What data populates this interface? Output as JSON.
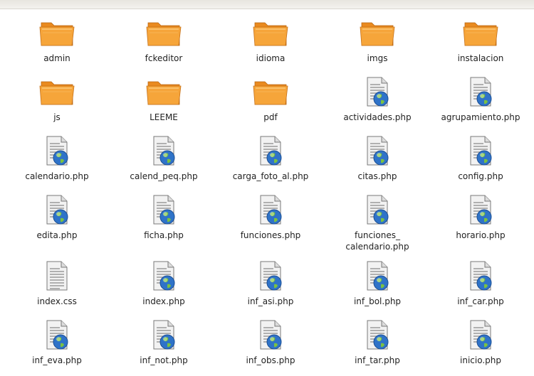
{
  "files": [
    {
      "name": "admin",
      "type": "folder"
    },
    {
      "name": "fckeditor",
      "type": "folder"
    },
    {
      "name": "idioma",
      "type": "folder"
    },
    {
      "name": "imgs",
      "type": "folder"
    },
    {
      "name": "instalacion",
      "type": "folder"
    },
    {
      "name": "js",
      "type": "folder"
    },
    {
      "name": "LEEME",
      "type": "folder"
    },
    {
      "name": "pdf",
      "type": "folder"
    },
    {
      "name": "actividades.php",
      "type": "php"
    },
    {
      "name": "agrupamiento.php",
      "type": "php"
    },
    {
      "name": "calendario.php",
      "type": "php"
    },
    {
      "name": "calend_peq.php",
      "type": "php"
    },
    {
      "name": "carga_foto_al.php",
      "type": "php"
    },
    {
      "name": "citas.php",
      "type": "php"
    },
    {
      "name": "config.php",
      "type": "php"
    },
    {
      "name": "edita.php",
      "type": "php"
    },
    {
      "name": "ficha.php",
      "type": "php"
    },
    {
      "name": "funciones.php",
      "type": "php"
    },
    {
      "name": "funciones_\ncalendario.php",
      "type": "php"
    },
    {
      "name": "horario.php",
      "type": "php"
    },
    {
      "name": "index.css",
      "type": "css"
    },
    {
      "name": "index.php",
      "type": "php"
    },
    {
      "name": "inf_asi.php",
      "type": "php"
    },
    {
      "name": "inf_bol.php",
      "type": "php"
    },
    {
      "name": "inf_car.php",
      "type": "php"
    },
    {
      "name": "inf_eva.php",
      "type": "php"
    },
    {
      "name": "inf_not.php",
      "type": "php"
    },
    {
      "name": "inf_obs.php",
      "type": "php"
    },
    {
      "name": "inf_tar.php",
      "type": "php"
    },
    {
      "name": "inicio.php",
      "type": "php"
    }
  ],
  "colors": {
    "folder_back": "#e98a1f",
    "folder_front": "#f6a53a",
    "folder_highlight": "#fbc877",
    "doc_page": "#f2f2f2",
    "doc_lines": "#9a9a9a",
    "globe_blue": "#2f73c8",
    "globe_green": "#7ac143"
  }
}
